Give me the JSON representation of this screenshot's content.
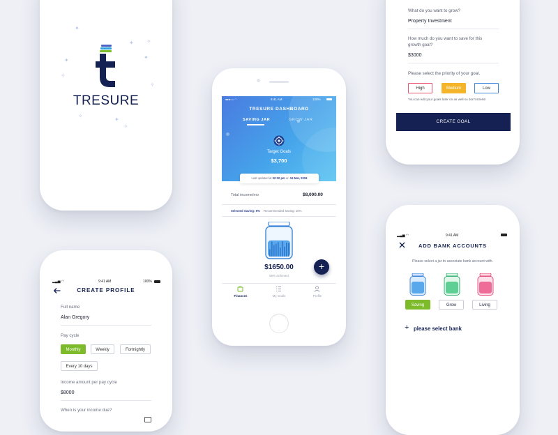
{
  "splash": {
    "brand": "TRESURE"
  },
  "profile": {
    "status_time": "9:41 AM",
    "status_battery": "100%",
    "title": "CREATE PROFILE",
    "full_name_label": "Full name",
    "full_name_value": "Alan Gregory",
    "pay_cycle_label": "Pay cycle",
    "pay_cycle_options": [
      "Monthly",
      "Weekly",
      "Fortnightly",
      "Every 10 days"
    ],
    "income_label": "Income amount per pay cycle",
    "income_value": "$8000",
    "due_label": "When is your income due?"
  },
  "dash": {
    "status_time": "9:41 AM",
    "status_battery": "100%",
    "title": "TRESURE DASHBOARD",
    "tabs": [
      "SAVING JAR",
      "GROW JAR"
    ],
    "target_label": "Target Goals",
    "target_value": "$3,700",
    "updated_prefix": "Last updated at",
    "updated_time": "02:30 pm",
    "updated_on": "on",
    "updated_date": "16 Mar, 2018",
    "income_label": "Total income/mo",
    "income_value": "$8,000.00",
    "selected_saving": "Selected Saving: 5%",
    "recommended_saving": "Recommended Saving: 10%",
    "jar_amount": "$1650.00",
    "jar_achieved": "55% achieved",
    "jar_fill_percent": 55,
    "nav": [
      "Finances",
      "My Goals",
      "Profile"
    ]
  },
  "goal": {
    "q1": "What do you want to grow?",
    "q1_value": "Property Investment",
    "q2": "How much do you want to save for this growth goal?",
    "q2_value": "$3000",
    "q3": "Please select the priority of your goal.",
    "priorities": [
      "High",
      "Medium",
      "Low"
    ],
    "note": "You can edit your goals later on as well so don't stress!",
    "create_button": "CREATE GOAL"
  },
  "bank": {
    "status_time": "9:41 AM",
    "title": "ADD BANK ACCOUNTS",
    "subtitle": "Please select a jar to associate bank account with.",
    "jars": [
      "Saving",
      "Grow",
      "Living"
    ],
    "select_bank": "please select bank"
  },
  "colors": {
    "navy": "#142152",
    "green": "#7dbb2a",
    "orange": "#f4b52a",
    "pink": "#e9546f",
    "blue": "#3f86d9"
  }
}
